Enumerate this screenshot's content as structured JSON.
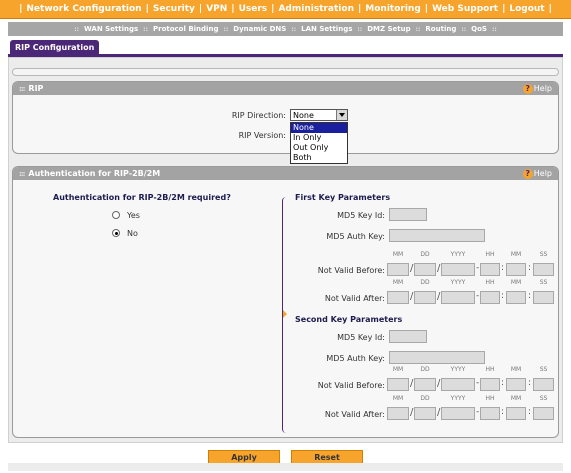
{
  "topnav": {
    "items": [
      "Network Configuration",
      "Security",
      "VPN",
      "Users",
      "Administration",
      "Monitoring",
      "Web Support",
      "Logout"
    ]
  },
  "subnav": {
    "items": [
      "WAN Settings",
      "Protocol Binding",
      "Dynamic DNS",
      "LAN Settings",
      "DMZ Setup",
      "Routing",
      "QoS"
    ]
  },
  "tab": {
    "label": "RIP Configuration"
  },
  "rip": {
    "title": "RIP",
    "help": "Help",
    "direction_label": "RIP Direction:",
    "direction_value": "None",
    "direction_options": [
      "None",
      "In Only",
      "Out Only",
      "Both"
    ],
    "version_label": "RIP Version:"
  },
  "auth": {
    "title": "Authentication for RIP-2B/2M",
    "help": "Help",
    "question": "Authentication for RIP-2B/2M required?",
    "yes": "Yes",
    "no": "No",
    "selected": "No"
  },
  "first_key": {
    "title": "First Key Parameters",
    "id_label": "MD5 Key Id:",
    "auth_label": "MD5 Auth Key:",
    "before_label": "Not Valid Before:",
    "after_label": "Not Valid After:"
  },
  "second_key": {
    "title": "Second Key Parameters",
    "id_label": "MD5 Key Id:",
    "auth_label": "MD5 Auth Key:",
    "before_label": "Not Valid Before:",
    "after_label": "Not Valid After:"
  },
  "date_headers": {
    "mm": "MM",
    "dd": "DD",
    "yyyy": "YYYY",
    "hh": "HH",
    "min": "MM",
    "ss": "SS"
  },
  "separators": {
    "slash": "/",
    "dash": "-",
    "colon": ":"
  },
  "buttons": {
    "apply": "Apply",
    "reset": "Reset"
  },
  "icons": {
    "help": "help-circle-icon",
    "dropdown": "chevron-down-icon"
  },
  "colors": {
    "nav": "#f7a42c",
    "purple": "#4b2778",
    "selected": "#1a1f9e"
  }
}
